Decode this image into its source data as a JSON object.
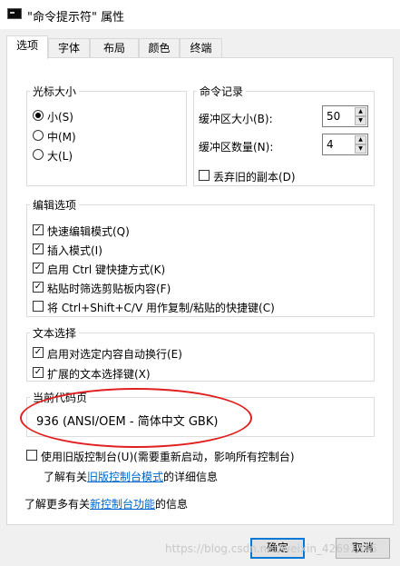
{
  "window": {
    "title": "\"命令提示符\" 属性"
  },
  "tabs": [
    "选项",
    "字体",
    "布局",
    "颜色",
    "终端"
  ],
  "cursor_size": {
    "legend": "光标大小",
    "options": [
      {
        "label": "小(S)",
        "selected": true
      },
      {
        "label": "中(M)",
        "selected": false
      },
      {
        "label": "大(L)",
        "selected": false
      }
    ]
  },
  "command_history": {
    "legend": "命令记录",
    "buffer_size_label": "缓冲区大小(B):",
    "buffer_size_value": "50",
    "buffer_count_label": "缓冲区数量(N):",
    "buffer_count_value": "4",
    "discard_label": "丢弃旧的副本(D)",
    "discard_checked": false
  },
  "edit_options": {
    "legend": "编辑选项",
    "items": [
      {
        "label": "快速编辑模式(Q)",
        "checked": true
      },
      {
        "label": "插入模式(I)",
        "checked": true
      },
      {
        "label": "启用 Ctrl 键快捷方式(K)",
        "checked": true
      },
      {
        "label": "粘贴时筛选剪贴板内容(F)",
        "checked": true
      },
      {
        "label": "将 Ctrl+Shift+C/V 用作复制/粘贴的快捷键(C)",
        "checked": false
      }
    ]
  },
  "text_selection": {
    "legend": "文本选择",
    "items": [
      {
        "label": "启用对选定内容自动换行(E)",
        "checked": true
      },
      {
        "label": "扩展的文本选择键(X)",
        "checked": true
      }
    ]
  },
  "codepage": {
    "legend": "当前代码页",
    "value": "936   (ANSI/OEM - 简体中文 GBK)"
  },
  "legacy": {
    "label": "使用旧版控制台(U)(需要重新启动，影响所有控制台)",
    "checked": false,
    "info_prefix": "了解有关",
    "info_link": "旧版控制台模式",
    "info_suffix": "的详细信息"
  },
  "more_info": {
    "prefix": "了解更多有关",
    "link": "新控制台功能",
    "suffix": "的信息"
  },
  "buttons": {
    "ok": "确定",
    "cancel": "取消"
  },
  "watermark": "https://blog.csdn.net/weixin_42691345",
  "colors": {
    "accent": "#0078d7",
    "link": "#0066cc",
    "annotation": "#e02020"
  }
}
